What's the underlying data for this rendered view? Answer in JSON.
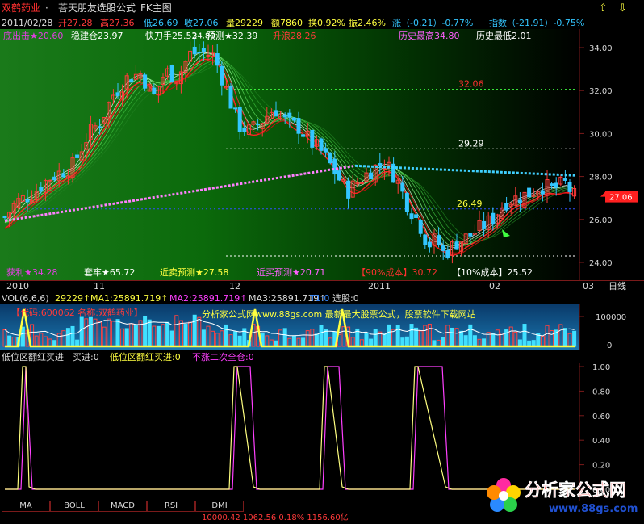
{
  "header": {
    "stock_name": "双鹤药业",
    "formula_title": "菩天朋友选股公式",
    "chart_mode": "FK主图",
    "up_arrow": "⇧",
    "down_arrow": "⇩"
  },
  "quote": {
    "date": "2011/02/28",
    "open": "开27.28",
    "high": "高27.36",
    "low": "低26.69",
    "close": "收27.06",
    "volume": "量29229",
    "amount": "额7860",
    "turnover": "换0.92%",
    "amplitude": "振2.46%",
    "change": "涨（-0.21）-0.77%",
    "index": "指数（-21.91）-0.75%"
  },
  "indicators_top": {
    "rebound": "底出击★20.60",
    "steady": "稳建仓23.97",
    "quick_knife": "快刀手25.52",
    "forecast": "预测★32.39",
    "rise": "升浪28.26",
    "hist_high": "历史最高34.80",
    "hist_low": "历史最低2.01"
  },
  "indicators_bottom": {
    "profit": "获利★34.28",
    "trapped": "套牢★65.72",
    "near_sell": "近卖预测★27.58",
    "near_buy": "近买预测★20.71",
    "cost90": "【90%成本】30.72",
    "cost10": "【10%成本】25.52"
  },
  "price_axis": [
    "34.00",
    "32.00",
    "30.00",
    "28.00",
    "26.00",
    "24.00"
  ],
  "price_markers": {
    "high_label": "34.80",
    "line1": "32.06",
    "line2": "29.29",
    "line3": "26.49",
    "current": "27.06"
  },
  "date_axis": [
    "2010",
    "11",
    "12",
    "2011",
    "02",
    "03"
  ],
  "period_label": "日线",
  "volume": {
    "params": "VOL(6,6,6)",
    "vol": "29229↑",
    "ma1": "MA1:25891.719↑",
    "ma2": "MA2:25891.719↑",
    "ma3": "MA3:25891.719↑",
    "t1": "T1:0",
    "select": "选股:0",
    "code_label": "【代码:600062 名称:双鹤药业】",
    "watermark": "分析家公式网www.88gs.com 最新最大股票公式，股票软件下载网站",
    "axis_top": "100000",
    "axis_bottom": "0"
  },
  "signal": {
    "title": "低位区翻红买进",
    "buy": "买进:0",
    "low_red": "低位区翻红买进:0",
    "not_rise": "不涨二次全仓:0",
    "axis": [
      "1.00",
      "0.80",
      "0.60",
      "0.40",
      "0.20",
      "0.00"
    ]
  },
  "tabs": [
    "MA",
    "BOLL",
    "MACD",
    "RSI",
    "DMI"
  ],
  "logo": {
    "brand": "分析家公式网",
    "url": "www.88gs.com"
  },
  "status": "10000.42  1062.56  0.18%  1156.60亿",
  "colors": {
    "up": "#ff3a3a",
    "down": "#33c6ff",
    "yellow": "#ffff40",
    "magenta": "#ff40ff",
    "main_bg": "#0d5c0d"
  }
}
